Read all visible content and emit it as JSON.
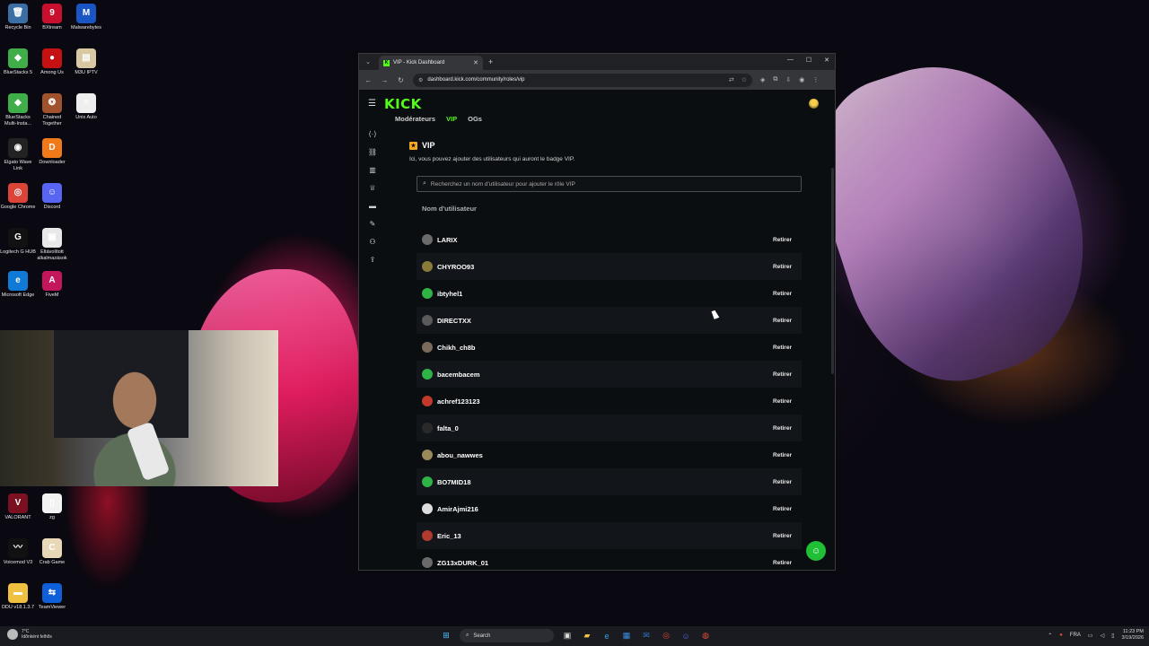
{
  "desktop": {
    "icons": [
      {
        "label": "Recycle Bin",
        "glyph": "🗑",
        "color": "#3a6ea5"
      },
      {
        "label": "BXtream",
        "glyph": "9",
        "color": "#c8102e"
      },
      {
        "label": "Malwarebytes",
        "glyph": "M",
        "color": "#1a55c4"
      },
      {
        "label": "BlueStacks 5",
        "glyph": "◆",
        "color": "#3fae49"
      },
      {
        "label": "Among Us",
        "glyph": "●",
        "color": "#c51111"
      },
      {
        "label": "M3U IPTV",
        "glyph": "▤",
        "color": "#d9c9a3"
      },
      {
        "label": "BlueStacks Multi-Insta...",
        "glyph": "◆",
        "color": "#3fae49"
      },
      {
        "label": "Chained Together",
        "glyph": "❂",
        "color": "#a0522d"
      },
      {
        "label": "Unix Auto",
        "glyph": "≡",
        "color": "#eeeeee"
      },
      {
        "label": "Elgato Wave Link",
        "glyph": "◉",
        "color": "#222222"
      },
      {
        "label": "Downloader",
        "glyph": "D",
        "color": "#f07a1a"
      },
      {
        "label": "Google Chrome",
        "glyph": "◎",
        "color": "#db4437"
      },
      {
        "label": "Discord",
        "glyph": "☺",
        "color": "#5865f2"
      },
      {
        "label": "Logitech G HUB",
        "glyph": "G",
        "color": "#111111"
      },
      {
        "label": "Eltávolított alkalmazások",
        "glyph": "▣",
        "color": "#e8e8e8"
      },
      {
        "label": "Microsoft Edge",
        "glyph": "e",
        "color": "#0f7bd6"
      },
      {
        "label": "FiveM",
        "glyph": "A",
        "color": "#c2185b"
      },
      {
        "label": "VALORANT",
        "glyph": "V",
        "color": "#7b1020"
      },
      {
        "label": "zg",
        "glyph": "▯",
        "color": "#f2f2f2"
      },
      {
        "label": "Voicemod V3",
        "glyph": "〰",
        "color": "#111111"
      },
      {
        "label": "Crab Game",
        "glyph": "C",
        "color": "#e8d8b8"
      },
      {
        "label": "DDU v18.1.3.7",
        "glyph": "▬",
        "color": "#f0c040"
      },
      {
        "label": "TeamViewer",
        "glyph": "⇆",
        "color": "#0e5fd8"
      }
    ]
  },
  "browser": {
    "tab_title": "VIP - Kick Dashboard",
    "new_tab": "+",
    "url": "dashboard.kick.com/community/roles/vip"
  },
  "kick": {
    "logo": "KICK",
    "subtabs": [
      "Modérateurs",
      "VIP",
      "OGs"
    ],
    "section_title": "VIP",
    "section_desc": "Ici, vous pouvez ajouter des utilisateurs qui auront le badge VIP.",
    "search_placeholder": "Recherchez un nom d'utilisateur pour ajouter le rôle VIP",
    "column_header": "Nom d'utilisateur",
    "remove_label": "Retirer",
    "users": [
      {
        "name": "LARIX",
        "avatar_color": "#6b6b6b"
      },
      {
        "name": "CHYROO93",
        "avatar_color": "#8a7a3a"
      },
      {
        "name": "ibtyhel1",
        "avatar_color": "#2fb344"
      },
      {
        "name": "DIRECTXX",
        "avatar_color": "#5a5a5a"
      },
      {
        "name": "Chikh_ch8b",
        "avatar_color": "#7a6a5a"
      },
      {
        "name": "bacembacem",
        "avatar_color": "#2fb344"
      },
      {
        "name": "achref123123",
        "avatar_color": "#c0392b"
      },
      {
        "name": "falta_0",
        "avatar_color": "#2a2a2a"
      },
      {
        "name": "abou_nawwes",
        "avatar_color": "#9a8a5a"
      },
      {
        "name": "BO7MID18",
        "avatar_color": "#2fb344"
      },
      {
        "name": "AmirAjmi216",
        "avatar_color": "#dddddd"
      },
      {
        "name": "Eric_13",
        "avatar_color": "#b03a2e"
      },
      {
        "name": "ZG13xDURK_01",
        "avatar_color": "#6a6a6a"
      }
    ]
  },
  "taskbar": {
    "weather_temp": "7°C",
    "weather_desc": "Időnként felhős",
    "search_label": "Search",
    "lang": "FRA",
    "time": "11:23 PM",
    "date": "3/19/2026"
  }
}
